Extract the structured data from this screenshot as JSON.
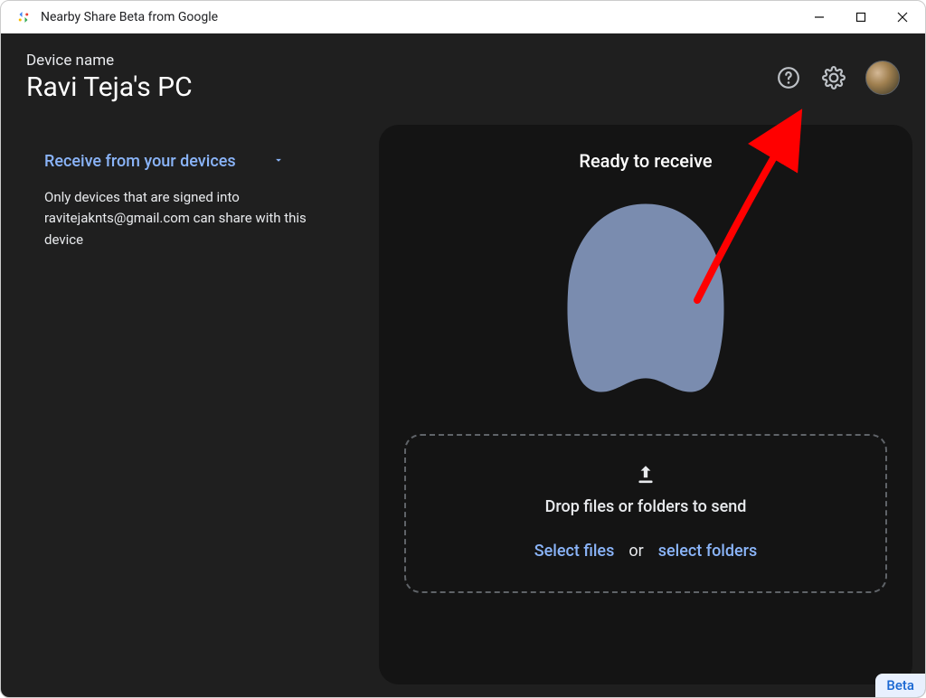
{
  "window": {
    "title": "Nearby Share Beta from Google"
  },
  "header": {
    "device_label": "Device name",
    "device_name": "Ravi Teja's PC"
  },
  "sidebar": {
    "receive_mode_label": "Receive from your devices",
    "receive_desc": "Only devices that are signed into ravitejaknts@gmail.com can share with this device"
  },
  "main": {
    "ready_label": "Ready to receive",
    "drop_label": "Drop files or folders to send",
    "select_files": "Select files",
    "or_label": "or",
    "select_folders": "select folders"
  },
  "badge": {
    "beta": "Beta"
  },
  "colors": {
    "accent": "#8ab4f8",
    "bg_dark": "#1f1f1f",
    "panel": "#141414",
    "blob": "#7a8caf"
  }
}
